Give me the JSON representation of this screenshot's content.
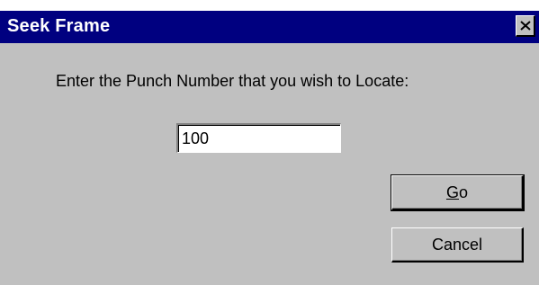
{
  "window": {
    "title": "Seek Frame",
    "close_icon": "close-icon"
  },
  "form": {
    "prompt": "Enter the Punch Number that you wish to Locate:",
    "punch_value": "100"
  },
  "buttons": {
    "go_mnemonic": "G",
    "go_rest": "o",
    "cancel_label": "Cancel"
  },
  "colors": {
    "titlebar": "#000080",
    "dialog_face": "#c0c0c0",
    "title_text": "#ffffff"
  }
}
